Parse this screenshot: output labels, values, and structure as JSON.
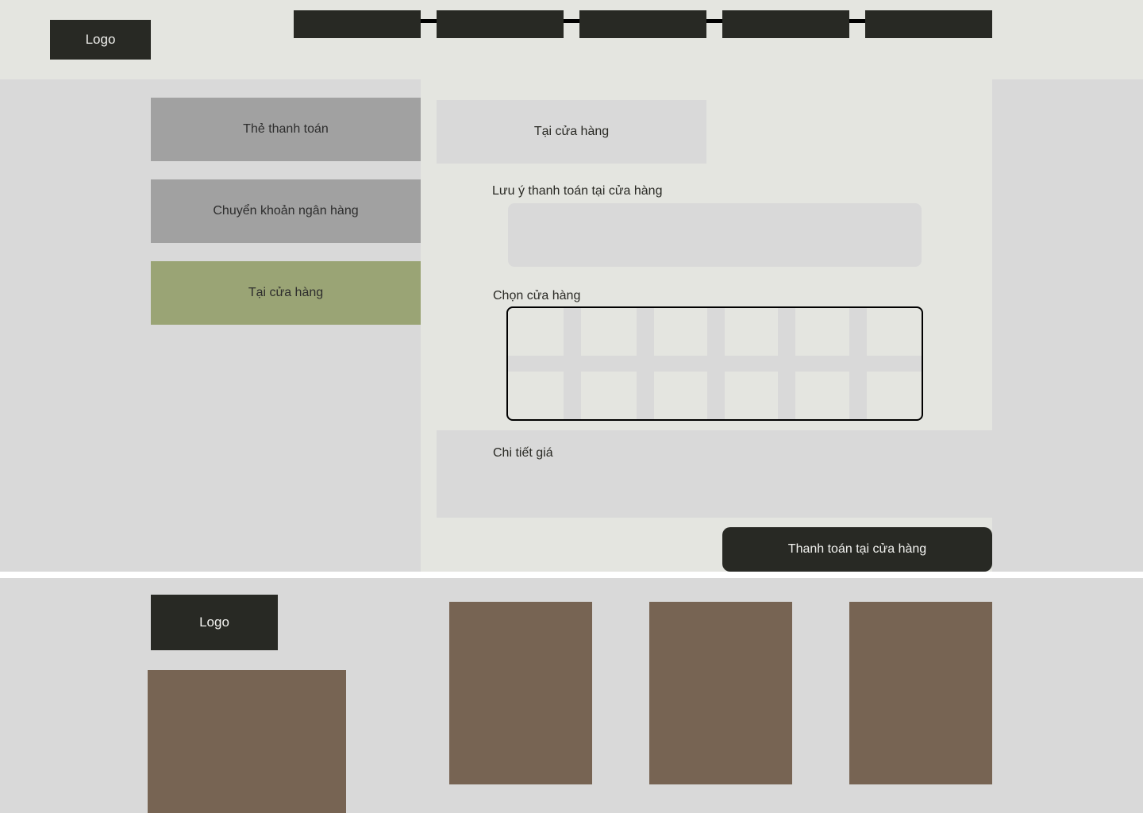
{
  "header": {
    "logo": "Logo",
    "nav_count": 5
  },
  "sidebar": {
    "items": [
      {
        "label": "Thẻ thanh toán",
        "active": false
      },
      {
        "label": "Chuyển khoản ngân hàng",
        "active": false
      },
      {
        "label": "Tại cửa hàng",
        "active": true
      }
    ]
  },
  "main": {
    "tab_label": "Tại cửa hàng",
    "note_label": "Lưu ý thanh toán tại cửa hàng",
    "store_label": "Chọn cửa hàng",
    "price_label": "Chi tiết giá",
    "pay_button": "Thanh toán tại cửa hàng"
  },
  "footer": {
    "logo": "Logo"
  },
  "colors": {
    "dark": "#282924",
    "accent": "#9aa475",
    "panel": "#e4e5e0",
    "placeholder": "#d9d9d9",
    "image": "#776453"
  }
}
